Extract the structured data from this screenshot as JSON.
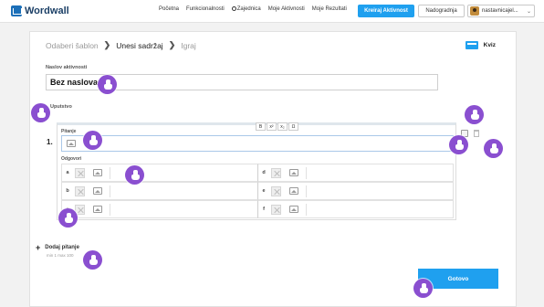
{
  "header": {
    "logo_text": "Wordwall",
    "nav": [
      "Početna",
      "Funkcionalnosti",
      "Zajednica",
      "Moje Aktivnosti",
      "Moje Rezultati"
    ],
    "create_button": "Kreiraj Aktivnost",
    "upgrade_button": "Nadogradnja",
    "username": "nastavnicajel...",
    "accent_color": "#1fa0ef"
  },
  "breadcrumb": {
    "step1": "Odaberi šablon",
    "sep": "❯",
    "step2": "Unesi sadržaj",
    "step3": "Igraj"
  },
  "template": {
    "name": "Kviz",
    "icon": "quiz-icon"
  },
  "form": {
    "title_label": "Naslov aktivnosti",
    "title_value": "Bez naslova",
    "instructions_label": "Uputstvo",
    "question_number": "1.",
    "question_label": "Pitanje",
    "answers_label": "Odgovori",
    "toolbar": [
      "B",
      "x²",
      "x₂",
      "Ω"
    ],
    "answers": [
      {
        "letter": "a"
      },
      {
        "letter": "d"
      },
      {
        "letter": "b"
      },
      {
        "letter": "e"
      },
      {
        "letter": "c"
      },
      {
        "letter": "f"
      }
    ],
    "add_question_label": "Dodaj pitanje",
    "add_question_hint": "min 1 max 100"
  },
  "done_button": "Gotovo"
}
